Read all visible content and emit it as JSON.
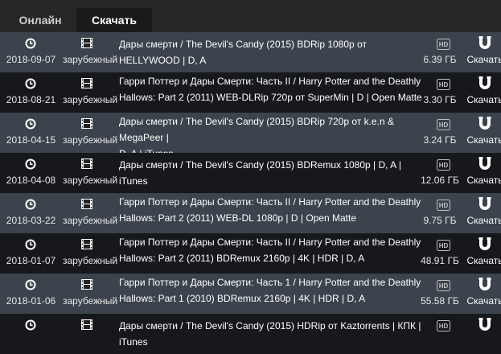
{
  "tabs": {
    "online": "Онлайн",
    "download": "Скачать"
  },
  "icons": {
    "date": "clock-icon",
    "category": "film-icon",
    "quality": "hd-icon",
    "download": "magnet-icon"
  },
  "colors": {
    "row_odd": "#3b434c",
    "row_even": "#16181b",
    "background": "#262626"
  },
  "rows": [
    {
      "date": "2018-09-07",
      "category": "зарубежный",
      "title_line1": "Дары смерти / The Devil's Candy (2015) BDRip 1080p от HELLYWOOD | D, A",
      "title_line2": "",
      "size": "6.39 ГБ",
      "download": "Скачать"
    },
    {
      "date": "2018-08-21",
      "category": "зарубежный",
      "title_line1": "Гарри Поттер и Дары Смерти: Часть II / Harry Potter and the Deathly",
      "title_line2": "Hallows: Part 2 (2011) WEB-DLRip 720p от SuperMin | D | Open Matte",
      "size": "3.30 ГБ",
      "download": "Скачать"
    },
    {
      "date": "2018-04-15",
      "category": "зарубежный",
      "title_line1": "Дары смерти / The Devil's Candy (2015) BDRip 720p от k.e.n & MegaPeer |",
      "title_line2": "D, A | iTunes",
      "size": "3.24 ГБ",
      "download": "Скачать"
    },
    {
      "date": "2018-04-08",
      "category": "зарубежный",
      "title_line1": "Дары смерти / The Devil's Candy (2015) BDRemux 1080p | D, A | iTunes",
      "title_line2": "",
      "size": "12.06 ГБ",
      "download": "Скачать"
    },
    {
      "date": "2018-03-22",
      "category": "зарубежный",
      "title_line1": "Гарри Поттер и Дары Смерти: Часть II / Harry Potter and the Deathly",
      "title_line2": "Hallows: Part 2 (2011) WEB-DL 1080p | D | Open Matte",
      "size": "9.75 ГБ",
      "download": "Скачать"
    },
    {
      "date": "2018-01-07",
      "category": "зарубежный",
      "title_line1": "Гарри Поттер и Дары Смерти: Часть II / Harry Potter and the Deathly",
      "title_line2": "Hallows: Part 2 (2011) BDRemux 2160p | 4K | HDR | D, A",
      "size": "48.91 ГБ",
      "download": "Скачать"
    },
    {
      "date": "2018-01-06",
      "category": "зарубежный",
      "title_line1": "Гарри Поттер и Дары Смерти: Часть 1 / Harry Potter and the Deathly",
      "title_line2": "Hallows: Part 1 (2010) BDRemux 2160p | 4K | HDR | D, A",
      "size": "55.58 ГБ",
      "download": "Скачать"
    },
    {
      "date": "",
      "category": "",
      "title_line1": "Дары смерти / The Devil's Candy (2015) HDRip от Kaztorrents | КПК | iTunes",
      "title_line2": "",
      "size": "",
      "download": ""
    }
  ]
}
